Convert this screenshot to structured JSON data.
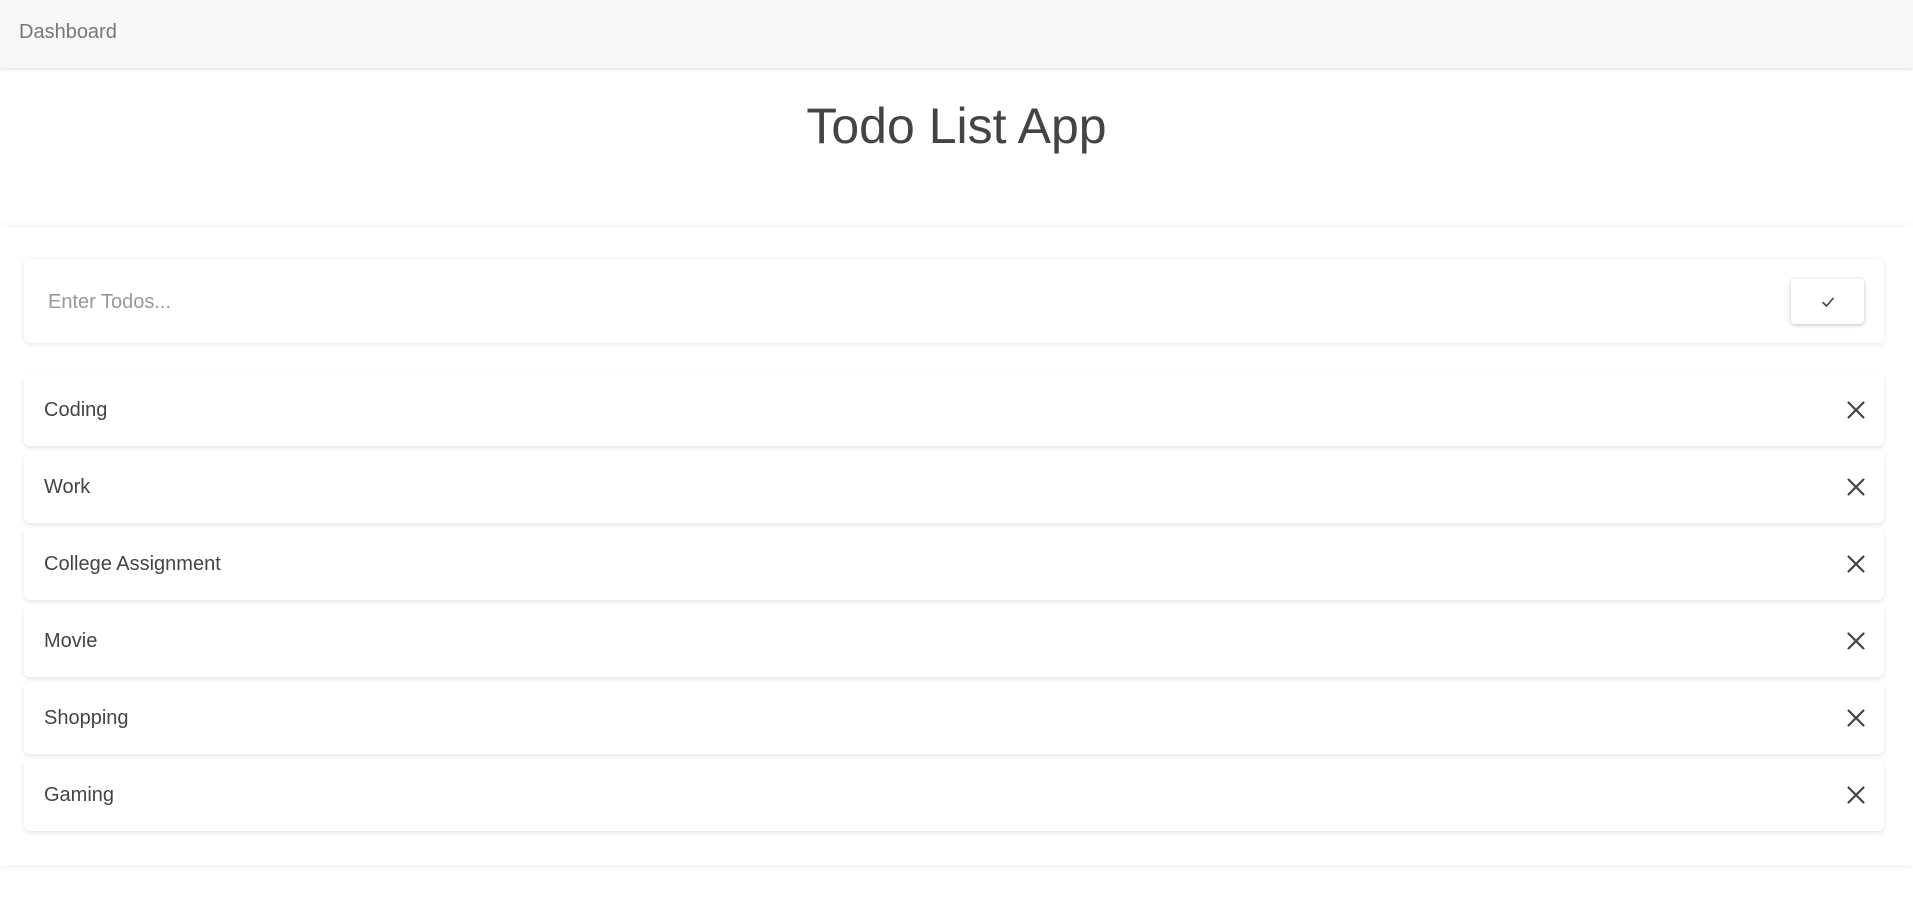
{
  "navbar": {
    "brand": "Dashboard"
  },
  "page": {
    "title": "Todo List App"
  },
  "input": {
    "placeholder": "Enter Todos...",
    "value": "",
    "submit_icon": "check-icon"
  },
  "todos": [
    {
      "text": "Coding",
      "delete_icon": "close-icon"
    },
    {
      "text": "Work",
      "delete_icon": "close-icon"
    },
    {
      "text": "College Assignment",
      "delete_icon": "close-icon"
    },
    {
      "text": "Movie",
      "delete_icon": "close-icon"
    },
    {
      "text": "Shopping",
      "delete_icon": "close-icon"
    },
    {
      "text": "Gaming",
      "delete_icon": "close-icon"
    }
  ],
  "colors": {
    "navbar_bg": "#f8f8f8",
    "text": "#444444",
    "brand_text": "#777777",
    "placeholder": "#999999"
  }
}
